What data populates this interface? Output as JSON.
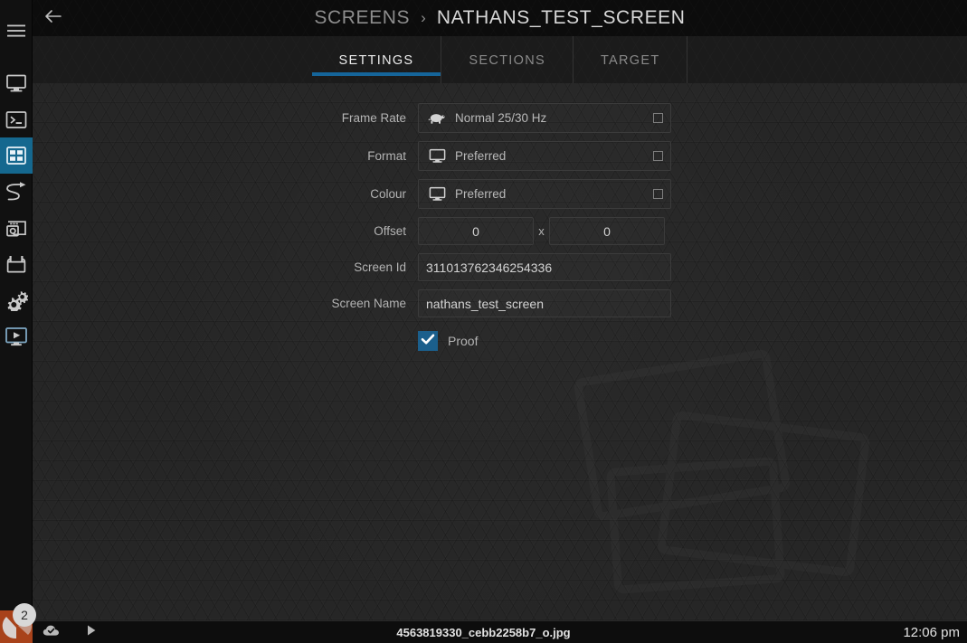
{
  "sidebar": {
    "items": [
      {
        "id": "menu",
        "icon": "hamburger-menu-icon",
        "label": "Menu",
        "active": false
      },
      {
        "id": "display",
        "icon": "monitor-icon",
        "label": "Display",
        "active": false
      },
      {
        "id": "terminal",
        "icon": "terminal-icon",
        "label": "Terminal",
        "active": false
      },
      {
        "id": "screens",
        "icon": "grid-screens-icon",
        "label": "Screens",
        "active": true
      },
      {
        "id": "routing",
        "icon": "cable-routing-icon",
        "label": "Routing",
        "active": false
      },
      {
        "id": "capture",
        "icon": "camera-capture-icon",
        "label": "Capture",
        "active": false
      },
      {
        "id": "calendar",
        "icon": "calendar-icon",
        "label": "Schedule",
        "active": false
      },
      {
        "id": "settings",
        "icon": "gears-icon",
        "label": "Settings",
        "active": false
      },
      {
        "id": "playback",
        "icon": "monitor-play-icon",
        "label": "Playback",
        "active": false
      }
    ]
  },
  "header": {
    "back_icon": "arrow-left-icon",
    "breadcrumb_parent": "SCREENS",
    "breadcrumb_separator": "›",
    "breadcrumb_current": "NATHANS_TEST_SCREEN"
  },
  "tabs": [
    {
      "id": "settings",
      "label": "SETTINGS",
      "active": true
    },
    {
      "id": "sections",
      "label": "SECTIONS",
      "active": false
    },
    {
      "id": "target",
      "label": "TARGET",
      "active": false
    }
  ],
  "form": {
    "frame_rate": {
      "label": "Frame Rate",
      "value": "Normal 25/30 Hz",
      "icon": "tortoise-icon",
      "dropdown_icon": "square-outline-icon"
    },
    "format": {
      "label": "Format",
      "value": "Preferred",
      "icon": "monitor-icon",
      "dropdown_icon": "square-outline-icon"
    },
    "colour": {
      "label": "Colour",
      "value": "Preferred",
      "icon": "monitor-icon",
      "dropdown_icon": "square-outline-icon"
    },
    "offset": {
      "label": "Offset",
      "x_value": "0",
      "y_value": "0",
      "separator": "x"
    },
    "screen_id": {
      "label": "Screen Id",
      "value": "311013762346254336"
    },
    "screen_name": {
      "label": "Screen Name",
      "value": "nathans_test_screen"
    },
    "proof": {
      "label": "Proof",
      "checked": true,
      "check_icon": "checkmark-icon"
    }
  },
  "statusbar": {
    "app_icon": "app-logo-icon",
    "badge_count": "2",
    "cloud_icon": "cloud-check-icon",
    "play_icon": "play-triangle-icon",
    "filename": "4563819330_cebb2258b7_o.jpg",
    "time": "12:06 pm"
  },
  "colors": {
    "accent_blue": "#15688f",
    "tab_underline": "#15659a",
    "checkbox_blue": "#1b5f8c",
    "app_badge_orange": "#a8421a",
    "panel_bg": "#262626",
    "sidebar_bg": "#111111"
  }
}
